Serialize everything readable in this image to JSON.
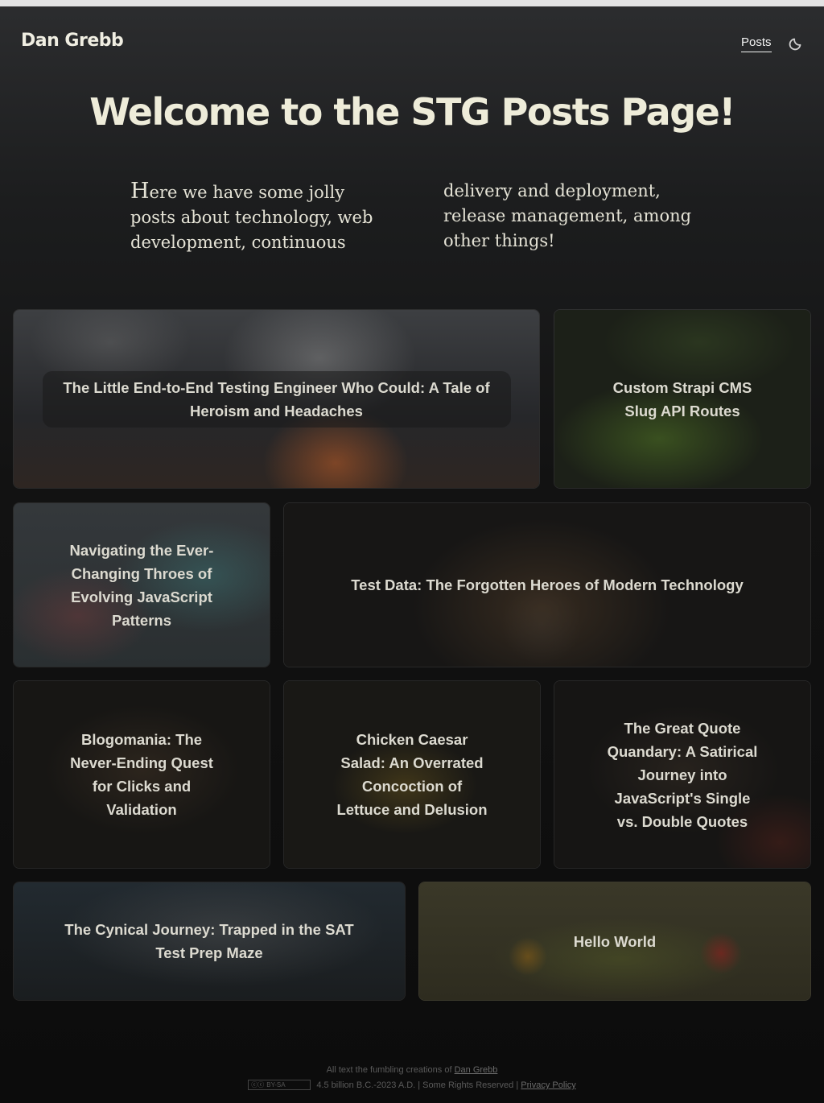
{
  "header": {
    "logo": "Dan Grebb",
    "nav_posts": "Posts",
    "theme_toggle_icon": "moon-icon"
  },
  "main": {
    "heading": "Welcome to the STG Posts Page!",
    "intro": "Here we have some jolly posts about technology, web development, continuous delivery and deployment, release management, among other things!"
  },
  "posts": [
    {
      "title": "The Little End-to-End Testing Engineer Who Could: A Tale of Heroism and Headaches"
    },
    {
      "title": "Custom Strapi CMS Slug API Routes"
    },
    {
      "title": "Navigating the Ever-Changing Throes of Evolving JavaScript Patterns"
    },
    {
      "title": "Test Data: The Forgotten Heroes of Modern Technology"
    },
    {
      "title": "Blogomania: The Never-Ending Quest for Clicks and Validation"
    },
    {
      "title": "Chicken Caesar Salad: An Overrated Concoction of Lettuce and Delusion"
    },
    {
      "title": "The Great Quote Quandary: A Satirical Journey into JavaScript's Single vs. Double Quotes"
    },
    {
      "title": "The Cynical Journey: Trapped in the SAT Test Prep Maze"
    },
    {
      "title": "Hello World"
    }
  ],
  "footer": {
    "line1_prefix": "All text the fumbling creations of",
    "author_link": "Dan Grebb",
    "cc_badge": "BY-SA",
    "line2_text": "4.5 billion B.C.-2023 A.D. | Some Rights Reserved |",
    "privacy_link": "Privacy Policy"
  }
}
